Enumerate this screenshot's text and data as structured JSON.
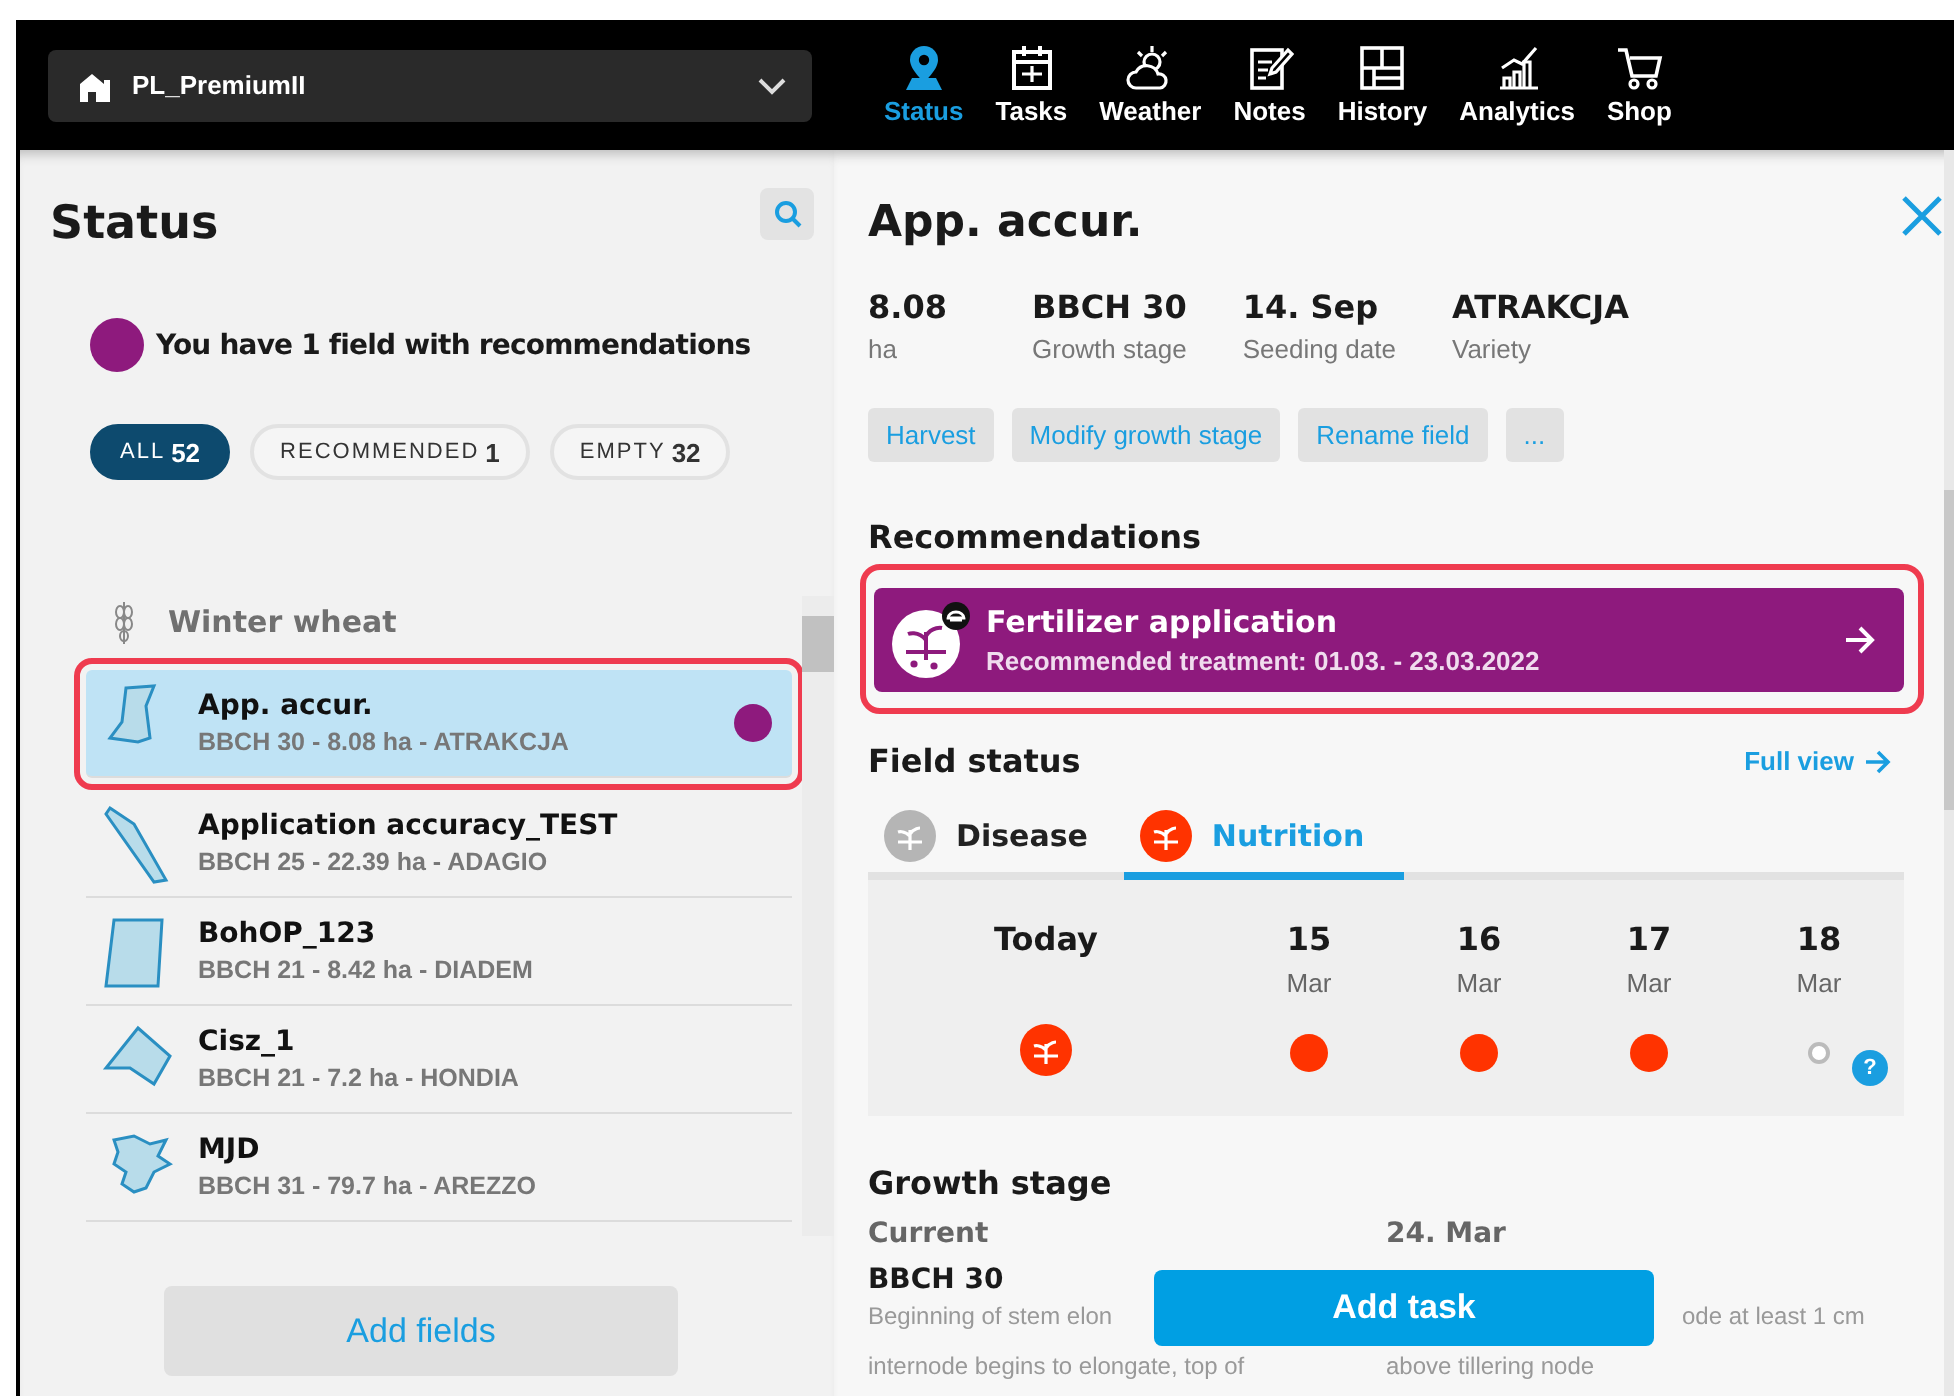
{
  "farm_selector": {
    "value": "PL_PremiumII"
  },
  "nav": [
    {
      "label": "Status",
      "selected": true
    },
    {
      "label": "Tasks",
      "selected": false
    },
    {
      "label": "Weather",
      "selected": false
    },
    {
      "label": "Notes",
      "selected": false
    },
    {
      "label": "History",
      "selected": false
    },
    {
      "label": "Analytics",
      "selected": false
    },
    {
      "label": "Shop",
      "selected": false
    }
  ],
  "sidebar": {
    "title": "Status",
    "notice": "You have 1 field with recommendations",
    "filters": [
      {
        "label": "ALL",
        "count": "52",
        "selected": true
      },
      {
        "label": "RECOMMENDED",
        "count": "1",
        "selected": false
      },
      {
        "label": "EMPTY",
        "count": "32",
        "selected": false
      }
    ],
    "group": "Winter wheat",
    "fields": [
      {
        "name": "App. accur.",
        "details": "BBCH 30 - 8.08 ha - ATRAKCJA",
        "selected": true,
        "recommended": true,
        "highlighted": true
      },
      {
        "name": "Application accuracy_TEST",
        "details": "BBCH 25 - 22.39 ha - ADAGIO",
        "selected": false,
        "recommended": false,
        "highlighted": false
      },
      {
        "name": "BohOP_123",
        "details": "BBCH 21 - 8.42 ha - DIADEM",
        "selected": false,
        "recommended": false,
        "highlighted": false
      },
      {
        "name": "Cisz_1",
        "details": "BBCH 21 - 7.2 ha - HONDIA",
        "selected": false,
        "recommended": false,
        "highlighted": false
      },
      {
        "name": "MJD",
        "details": "BBCH 31 - 79.7 ha - AREZZO",
        "selected": false,
        "recommended": false,
        "highlighted": false
      }
    ],
    "add_button": "Add fields"
  },
  "detail": {
    "title": "App. accur.",
    "stats": [
      {
        "value": "8.08",
        "label": "ha"
      },
      {
        "value": "BBCH 30",
        "label": "Growth stage"
      },
      {
        "value": "14. Sep",
        "label": "Seeding date"
      },
      {
        "value": "ATRAKCJA",
        "label": "Variety"
      }
    ],
    "actions": [
      "Harvest",
      "Modify growth stage",
      "Rename field",
      "..."
    ],
    "recommendations_heading": "Recommendations",
    "recommendation": {
      "title": "Fertilizer application",
      "subtitle": "Recommended treatment: 01.03. - 23.03.2022",
      "highlighted": true
    },
    "field_status_heading": "Field status",
    "full_view_link": "Full view",
    "status_tabs": [
      {
        "label": "Disease",
        "color": "#b5b5b5",
        "selected": false
      },
      {
        "label": "Nutrition",
        "color": "#ff3300",
        "selected": true
      }
    ],
    "forecast": [
      {
        "kind": "today",
        "day": "Today",
        "alert": true
      },
      {
        "kind": "date",
        "day": "15",
        "month": "Mar",
        "alert": true
      },
      {
        "kind": "date",
        "day": "16",
        "month": "Mar",
        "alert": true
      },
      {
        "kind": "date",
        "day": "17",
        "month": "Mar",
        "alert": true
      },
      {
        "kind": "date",
        "day": "18",
        "month": "Mar",
        "alert": false
      }
    ],
    "help": "?",
    "growth_heading": "Growth stage",
    "growth": [
      {
        "label": "Current",
        "stage": "BBCH 30",
        "lines": [
          "Beginning of stem elon",
          "internode begins to elongate, top of"
        ]
      },
      {
        "label": "24. Mar",
        "lines": [
          "ode at least 1 cm",
          "above tillering node"
        ]
      }
    ],
    "add_task_button": "Add task"
  }
}
